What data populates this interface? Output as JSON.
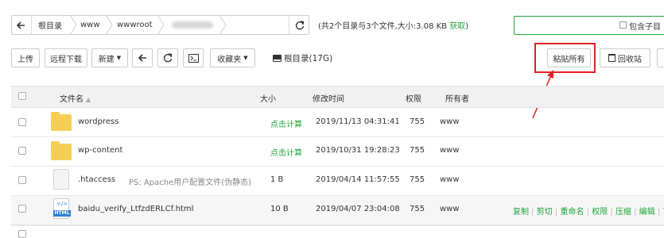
{
  "breadcrumb": {
    "back_icon": "arrow-left-icon",
    "segments": [
      "根目录",
      "www",
      "wwwroot"
    ],
    "refresh_icon": "refresh-icon"
  },
  "summary": {
    "text": "(共2个目录与3个文件,大小:3.08 KB",
    "fetch_label": "获取",
    "close": ")"
  },
  "subdir_option": {
    "label": "包含子目"
  },
  "toolbar": {
    "upload": "上传",
    "remote_download": "远程下载",
    "new": "新建",
    "favorites": "收藏夹",
    "root_label": "根目录(17G)",
    "paste_all": "粘贴所有",
    "recycle_bin": "回收站"
  },
  "table": {
    "headers": {
      "name": "文件名",
      "size": "大小",
      "modified": "修改时间",
      "perm": "权限",
      "owner": "所有者"
    },
    "rows": [
      {
        "icon": "folder-icon",
        "name": "wordpress",
        "note": "",
        "size": "点击计算",
        "size_is_action": true,
        "modified": "2019/11/13 04:31:41",
        "perm": "755",
        "owner": "www"
      },
      {
        "icon": "folder-icon",
        "name": "wp-content",
        "note": "",
        "size": "点击计算",
        "size_is_action": true,
        "modified": "2019/10/31 19:28:23",
        "perm": "755",
        "owner": "www"
      },
      {
        "icon": "file-icon",
        "name": ".htaccess",
        "note": "PS: Apache用户配置文件(伪静态)",
        "size": "1 B",
        "size_is_action": false,
        "modified": "2019/04/14 11:57:55",
        "perm": "755",
        "owner": "www"
      },
      {
        "icon": "html-file-icon",
        "name": "baidu_verify_LtfzdERLCf.html",
        "note": "",
        "size": "10 B",
        "size_is_action": false,
        "modified": "2019/04/07 23:04:08",
        "perm": "755",
        "owner": "www"
      }
    ],
    "row_actions": [
      "复制",
      "剪切",
      "重命名",
      "权限",
      "压缩",
      "编辑",
      "下"
    ]
  },
  "colors": {
    "accent": "#20a53a",
    "highlight": "#e02020",
    "folder": "#f7ce55"
  }
}
